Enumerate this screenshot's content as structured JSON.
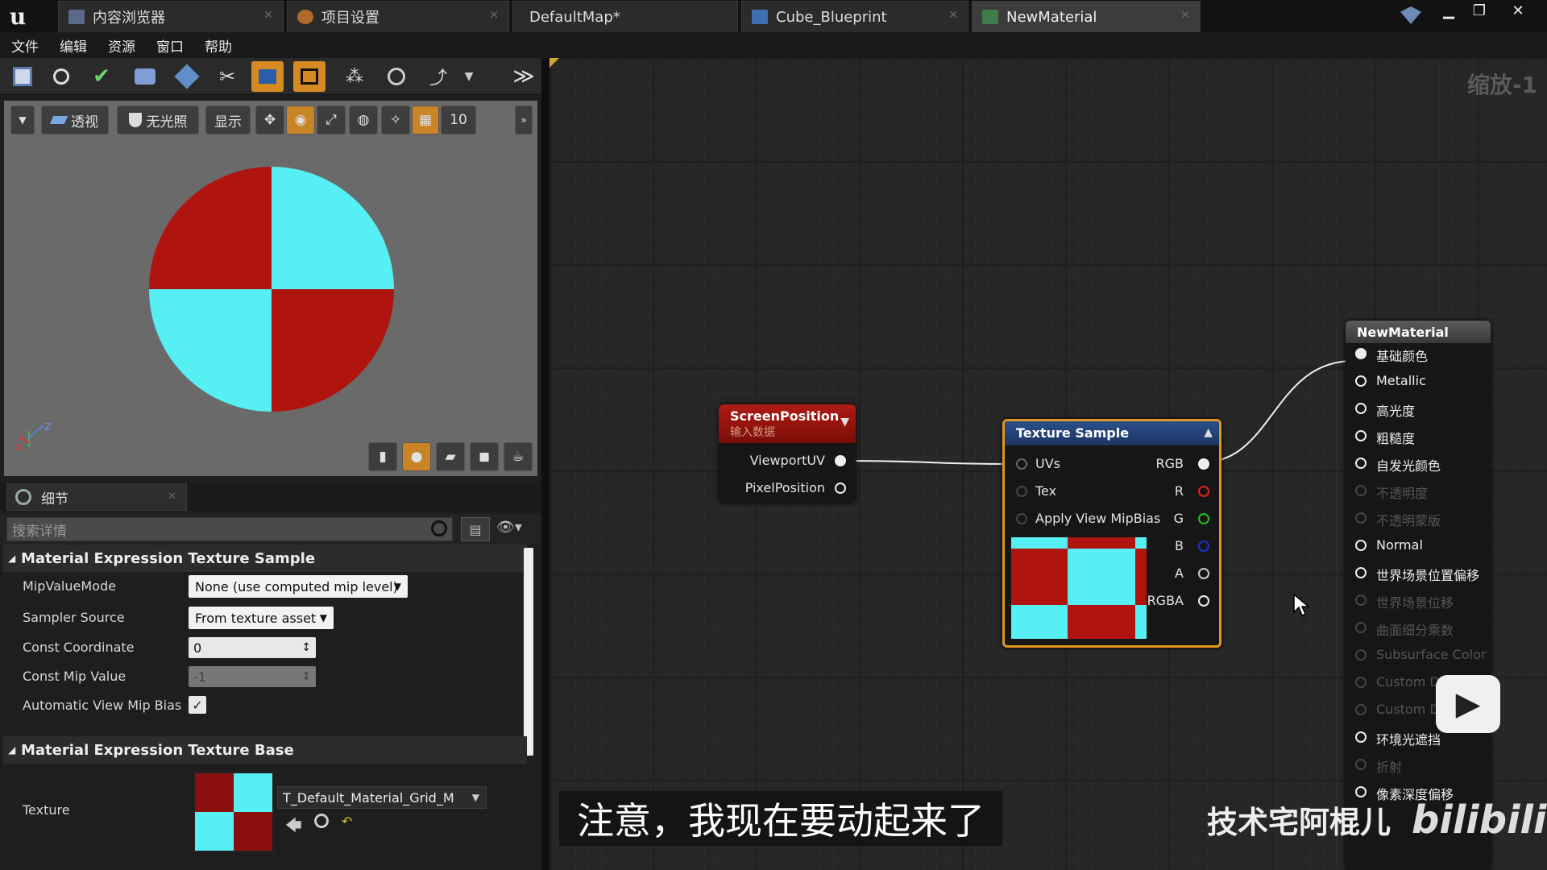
{
  "tabs": [
    {
      "label": "内容浏览器"
    },
    {
      "label": "项目设置"
    },
    {
      "label": "DefaultMap*"
    },
    {
      "label": "Cube_Blueprint"
    },
    {
      "label": "NewMaterial"
    }
  ],
  "menu": [
    "文件",
    "编辑",
    "资源",
    "窗口",
    "帮助"
  ],
  "viewport": {
    "perspective": "透视",
    "lighting": "无光照",
    "show": "显示",
    "grid_value": "10"
  },
  "details": {
    "tab_label": "细节",
    "search_placeholder": "搜索详情",
    "section1": "Material Expression Texture Sample",
    "props": [
      {
        "label": "MipValueMode",
        "value": "None (use computed mip level)"
      },
      {
        "label": "Sampler Source",
        "value": "From texture asset"
      },
      {
        "label": "Const Coordinate",
        "value": "0"
      },
      {
        "label": "Const Mip Value",
        "value": "-1"
      },
      {
        "label": "Automatic View Mip Bias",
        "value": "✓"
      }
    ],
    "section2": "Material Expression Texture Base",
    "texture_label": "Texture",
    "texture_asset": "T_Default_Material_Grid_M"
  },
  "graph": {
    "zoom": "缩放-1",
    "screenpos": {
      "title": "ScreenPosition",
      "subtitle": "输入数据",
      "outputs": [
        "ViewportUV",
        "PixelPosition"
      ]
    },
    "texsample": {
      "title": "Texture Sample",
      "inputs": [
        "UVs",
        "Tex",
        "Apply View MipBias"
      ],
      "outputs": [
        "RGB",
        "R",
        "G",
        "B",
        "A",
        "RGBA"
      ]
    },
    "material": {
      "title": "NewMaterial",
      "pins": [
        {
          "label": "基础颜色",
          "enabled": true
        },
        {
          "label": "Metallic",
          "enabled": true
        },
        {
          "label": "高光度",
          "enabled": true
        },
        {
          "label": "粗糙度",
          "enabled": true
        },
        {
          "label": "自发光颜色",
          "enabled": true
        },
        {
          "label": "不透明度",
          "enabled": false
        },
        {
          "label": "不透明蒙版",
          "enabled": false
        },
        {
          "label": "Normal",
          "enabled": true
        },
        {
          "label": "世界场景位置偏移",
          "enabled": true
        },
        {
          "label": "世界场景位移",
          "enabled": false
        },
        {
          "label": "曲面细分乘数",
          "enabled": false
        },
        {
          "label": "Subsurface Color",
          "enabled": false
        },
        {
          "label": "Custom D",
          "enabled": false
        },
        {
          "label": "Custom D",
          "enabled": false
        },
        {
          "label": "环境光遮挡",
          "enabled": true
        },
        {
          "label": "折射",
          "enabled": false
        },
        {
          "label": "像素深度偏移",
          "enabled": true
        }
      ]
    }
  },
  "overlay": {
    "subtitle": "注意，我现在要动起来了",
    "watermark": "技术宅阿棍儿",
    "logo": "bilibili"
  },
  "colors": {
    "red": "#b0140f",
    "cyan": "#56f0f4",
    "accent": "#e0961e"
  }
}
